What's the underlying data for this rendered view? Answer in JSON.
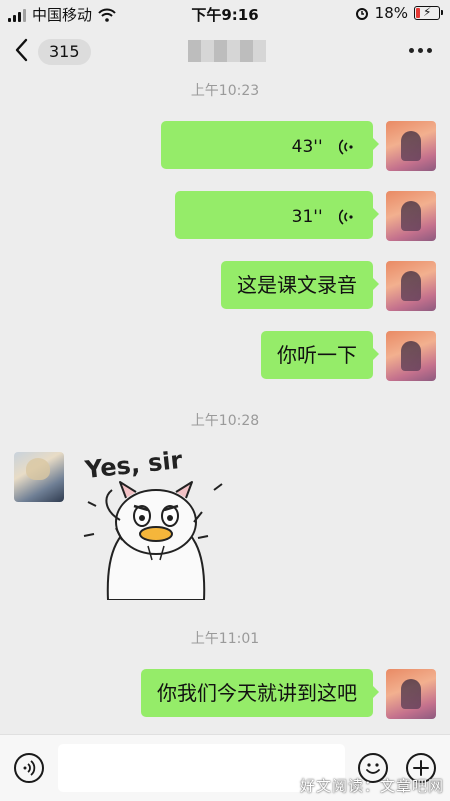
{
  "status_bar": {
    "carrier": "中国移动",
    "time": "下午9:16",
    "battery": "18%",
    "battery_level": 0.18
  },
  "nav": {
    "unread_count": "315"
  },
  "messages": [
    {
      "timestamp": "上午10:23"
    },
    {
      "from": "me",
      "type": "voice",
      "duration": "43''"
    },
    {
      "from": "me",
      "type": "voice",
      "duration": "31''"
    },
    {
      "from": "me",
      "type": "text",
      "text": "这是课文录音"
    },
    {
      "from": "me",
      "type": "text",
      "text": "你听一下"
    },
    {
      "timestamp": "上午10:28"
    },
    {
      "from": "other",
      "type": "sticker",
      "caption": "Yes, sir"
    },
    {
      "timestamp": "上午11:01"
    },
    {
      "from": "me",
      "type": "text",
      "text": "你我们今天就讲到这吧"
    }
  ],
  "watermark": "好文阅读：文章吧网",
  "colors": {
    "bubble_self": "#95ec69",
    "background": "#ededed"
  },
  "icons": {
    "back": "chevron-left-icon",
    "more": "more-dots-icon",
    "voice": "voice-wave-icon",
    "emoji": "emoji-icon",
    "plus": "plus-icon",
    "voice_input": "voice-input-icon"
  }
}
